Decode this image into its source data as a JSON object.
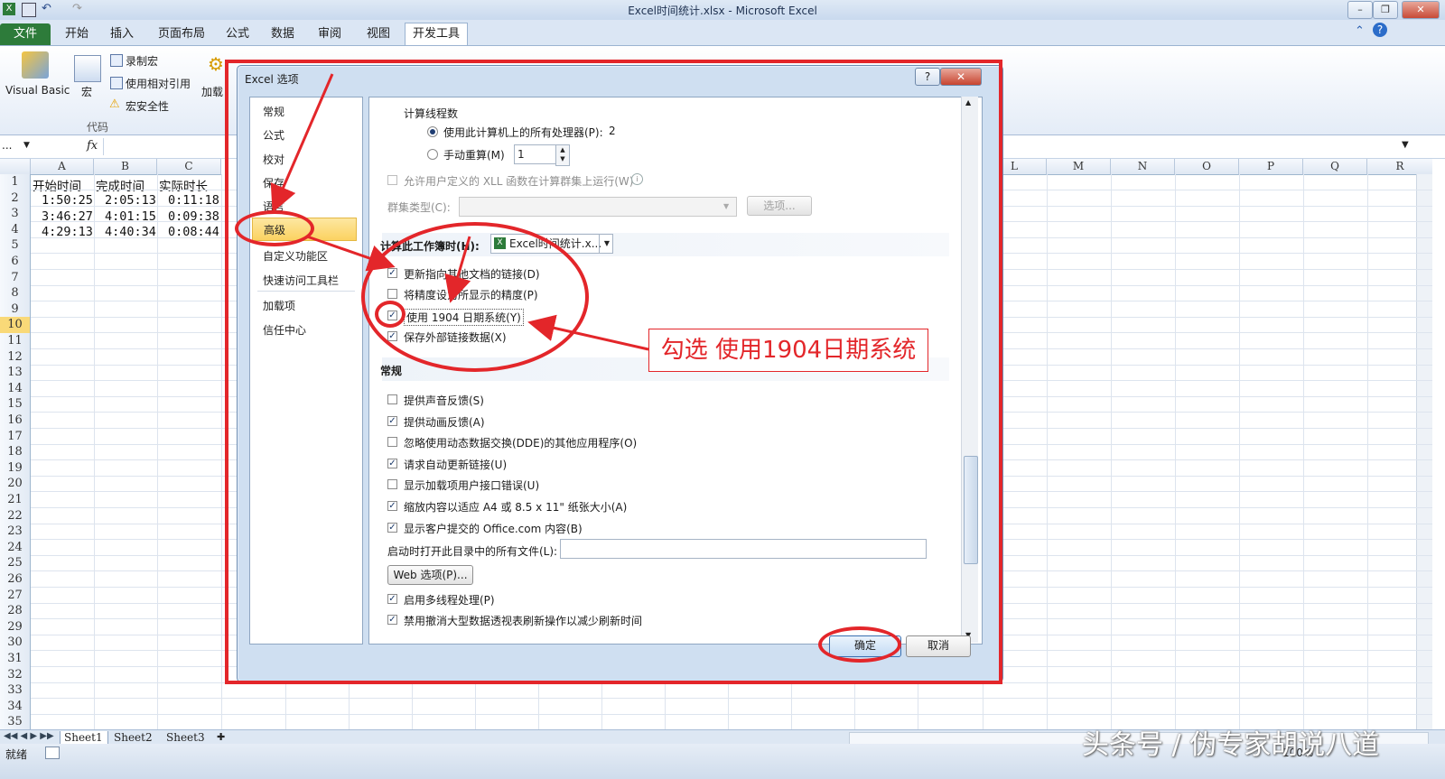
{
  "window": {
    "title": "Excel时间统计.xlsx - Microsoft Excel",
    "min": "–",
    "restore": "❐",
    "close": "✕"
  },
  "ribbon_tabs": [
    "文件",
    "开始",
    "插入",
    "页面布局",
    "公式",
    "数据",
    "审阅",
    "视图",
    "开发工具"
  ],
  "ribbon": {
    "visual_basic": "Visual Basic",
    "macro": "宏",
    "record_macro": "录制宏",
    "relative_ref": "使用相对引用",
    "macro_security": "宏安全性",
    "group_label": "代码",
    "addins": "加载"
  },
  "formula_bar": {
    "namebox": "...",
    "fx": "fx"
  },
  "grid": {
    "columns": [
      "A",
      "B",
      "C",
      "L",
      "M",
      "N",
      "O",
      "P",
      "Q",
      "R"
    ],
    "rows": [
      "1",
      "2",
      "3",
      "4",
      "5",
      "6",
      "7",
      "8",
      "9",
      "10",
      "11",
      "12",
      "13",
      "14",
      "15",
      "16",
      "17",
      "18",
      "19",
      "20",
      "21",
      "22",
      "23",
      "24",
      "25",
      "26",
      "27",
      "28",
      "29",
      "30",
      "31",
      "32",
      "33",
      "34",
      "35"
    ],
    "headers": [
      "开始时间",
      "完成时间",
      "实际时长"
    ],
    "data": [
      [
        "1:50:25",
        "2:05:13",
        "0:11:18"
      ],
      [
        "3:46:27",
        "4:01:15",
        "0:09:38"
      ],
      [
        "4:29:13",
        "4:40:34",
        "0:08:44"
      ]
    ]
  },
  "sheets": [
    "Sheet1",
    "Sheet2",
    "Sheet3"
  ],
  "status": {
    "ready": "就绪",
    "zoom": "100%"
  },
  "dialog": {
    "title": "Excel 选项",
    "help": "?",
    "close": "✕",
    "nav": [
      "常规",
      "公式",
      "校对",
      "保存",
      "语言",
      "高级",
      "自定义功能区",
      "快速访问工具栏",
      "加载项",
      "信任中心"
    ],
    "threads_title": "计算线程数",
    "use_all_processors": "使用此计算机上的所有处理器(P):",
    "processor_count": "2",
    "manual_threads": "手动重算(M)",
    "manual_value": "1",
    "xll_cluster": "允许用户定义的 XLL 函数在计算群集上运行(W)",
    "cluster_type": "群集类型(C):",
    "options_btn": "选项...",
    "when_calc_workbook": "计算此工作簿时(H):",
    "workbook_select": "Excel时间统计.x...",
    "update_links": "更新指向其他文档的链接(D)",
    "precision": "将精度设为所显示的精度(P)",
    "use_1904": "使用 1904 日期系统(Y)",
    "save_external": "保存外部链接数据(X)",
    "general_section": "常规",
    "general_items": [
      {
        "label": "提供声音反馈(S)",
        "checked": false
      },
      {
        "label": "提供动画反馈(A)",
        "checked": true
      },
      {
        "label": "忽略使用动态数据交换(DDE)的其他应用程序(O)",
        "checked": false
      },
      {
        "label": "请求自动更新链接(U)",
        "checked": true
      },
      {
        "label": "显示加载项用户接口错误(U)",
        "checked": false
      },
      {
        "label": "缩放内容以适应 A4 或 8.5 x 11\" 纸张大小(A)",
        "checked": true
      },
      {
        "label": "显示客户提交的 Office.com 内容(B)",
        "checked": true
      }
    ],
    "startup_dir": "启动时打开此目录中的所有文件(L):",
    "web_options": "Web 选项(P)...",
    "multithread": "启用多线程处理(P)",
    "pivot_refresh": "禁用撤消大型数据透视表刷新操作以减少刷新时间",
    "ok": "确定",
    "cancel": "取消"
  },
  "annotation": {
    "callout": "勾选 使用1904日期系统",
    "color": "#e3262a"
  },
  "watermark": "头条号 / 伪专家胡说八道"
}
